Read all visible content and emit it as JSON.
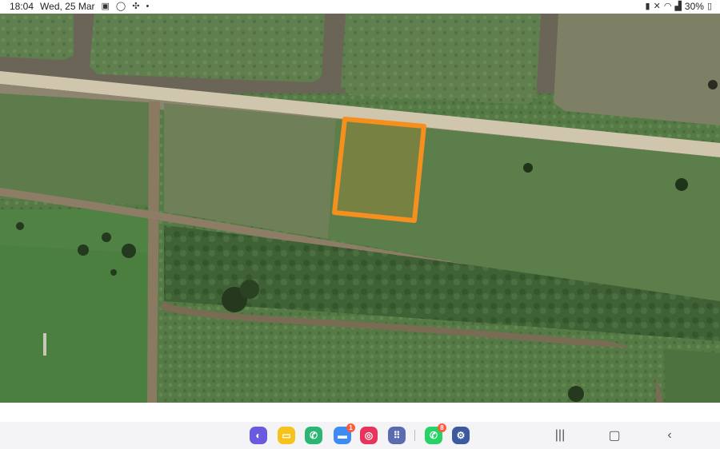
{
  "status_bar": {
    "time": "18:04",
    "date": "Wed, 25 Mar",
    "notification_icons": [
      "gallery-icon",
      "whatsapp-icon",
      "fan-icon",
      "dot-icon"
    ],
    "system_icons": [
      "battery-saver-icon",
      "mute-icon",
      "wifi-icon",
      "signal-icon"
    ],
    "battery_percent": "30%"
  },
  "map": {
    "type": "satellite",
    "highlight_parcel_color": "#f5901e"
  },
  "taskbar": {
    "apps": [
      {
        "name": "internet",
        "badge": ""
      },
      {
        "name": "notes",
        "badge": ""
      },
      {
        "name": "phone",
        "badge": ""
      },
      {
        "name": "messages",
        "badge": "1"
      },
      {
        "name": "camera",
        "badge": ""
      },
      {
        "name": "apps-grid",
        "badge": ""
      },
      {
        "name": "whatsapp",
        "badge": "8"
      },
      {
        "name": "settings",
        "badge": ""
      }
    ],
    "nav": [
      "recents",
      "home",
      "back"
    ]
  }
}
